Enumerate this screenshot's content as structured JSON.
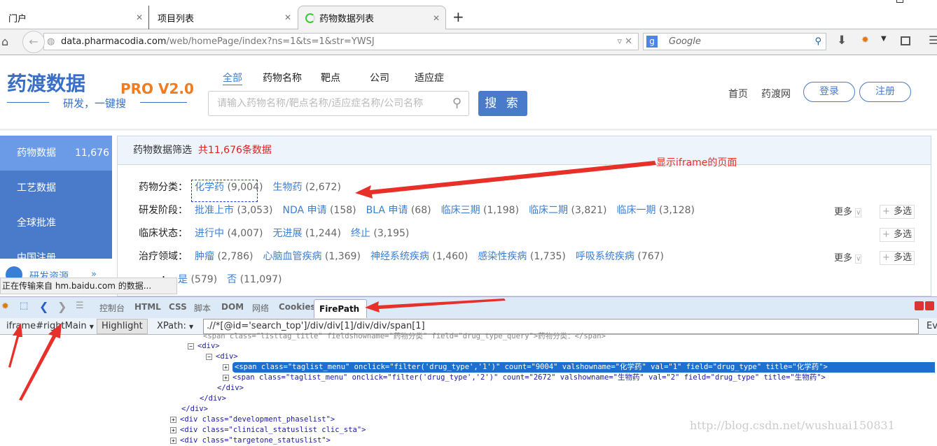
{
  "browser": {
    "tabs": [
      {
        "label": "门户"
      },
      {
        "label": "项目列表"
      },
      {
        "label": "药物数据列表",
        "active": true
      }
    ],
    "new_tab": "+",
    "url_host": "data.pharmacodia.com",
    "url_path": "/web/homePage/index?ns=1&ts=1&str=YWSJ",
    "search_engine": "Google"
  },
  "site": {
    "logo_name": "药渡数据",
    "logo_version": "PRO V2.0",
    "logo_slogan": "研发，一键搜",
    "categories": [
      "全部",
      "药物名称",
      "靶点",
      "公司",
      "适应症"
    ],
    "search_placeholder": "请输入药物名称/靶点名称/适应症名称/公司名称",
    "search_button": "搜 索",
    "links": [
      "首页",
      "药渡网"
    ],
    "login": "登录",
    "register": "注册"
  },
  "sidebar": {
    "items": [
      {
        "label": "药物数据",
        "count": "11,676",
        "active": true
      },
      {
        "label": "工艺数据"
      },
      {
        "label": "全球批准"
      },
      {
        "label": "中国注册"
      }
    ],
    "resources": "研发资源"
  },
  "filter": {
    "title": "药物数据筛选",
    "total": "共11,676条数据",
    "rows": [
      {
        "label": "药物分类：",
        "options": [
          [
            "化学药",
            "(9,004)"
          ],
          [
            "生物药",
            "(2,672)"
          ]
        ]
      },
      {
        "label": "研发阶段：",
        "options": [
          [
            "批准上市",
            "(3,053)"
          ],
          [
            "NDA 申请",
            "(158)"
          ],
          [
            "BLA 申请",
            "(68)"
          ],
          [
            "临床三期",
            "(1,198)"
          ],
          [
            "临床二期",
            "(3,821)"
          ],
          [
            "临床一期",
            "(3,128)"
          ]
        ]
      },
      {
        "label": "临床状态：",
        "options": [
          [
            "进行中",
            "(4,007)"
          ],
          [
            "无进展",
            "(1,244)"
          ],
          [
            "终止",
            "(3,195)"
          ]
        ]
      },
      {
        "label": "治疗领域：",
        "options": [
          [
            "肿瘤",
            "(2,786)"
          ],
          [
            "心脑血管疾病",
            "(1,369)"
          ],
          [
            "神经系统疾病",
            "(1,460)"
          ],
          [
            "感染性疾病",
            "(1,735)"
          ],
          [
            "呼吸系统疾病",
            "(767)"
          ]
        ]
      },
      {
        "label": "：",
        "options": [
          [
            "是",
            "(579)"
          ],
          [
            "否",
            "(11,097)"
          ]
        ]
      }
    ],
    "more": "更多",
    "multi": "多选"
  },
  "annotation": "显示iframe的页面",
  "status_text": "正在传输来自 hm.baidu.com 的数据...",
  "firebug": {
    "tabs": [
      "控制台",
      "HTML",
      "CSS",
      "脚本",
      "DOM",
      "网络",
      "Cookies",
      "FirePath"
    ],
    "frame": "iframe#rightMain",
    "highlight": "Highlight",
    "xpath_label": "XPath:",
    "xpath": ".//*[@id='search_top']/div/div[1]/div/div/span[1]",
    "ev": "Ev",
    "code": [
      "<span class=\"listtag_title\" fieldshowname=\"药物分类\" field=\"drug_type_query\">药物分类：</span>",
      "<div>",
      "<div>",
      "<span class=\"taglist_menu\" onclick=\"filter('drug_type','1')\" count=\"9004\" valshowname=\"化学药\" val=\"1\" field=\"drug_type\" title=\"化学药\">",
      "<span class=\"taglist_menu\" onclick=\"filter('drug_type','2')\" count=\"2672\" valshowname=\"生物药\" val=\"2\" field=\"drug_type\" title=\"生物药\">",
      "</div>",
      "</div>",
      "</div>",
      "<div class=\"development_phaselist\">",
      "<div class=\"clinical_statuslist clic_sta\">",
      "<div class=\"targetone_statuslist\">"
    ]
  },
  "watermark": "http://blog.csdn.net/wushuai150831",
  "colors": {
    "brand": "#4a7bcb",
    "accent": "#f07c22",
    "link": "#3a7fd5",
    "total": "#e02020",
    "arrow": "#e8302a",
    "selection": "#1f6fd1"
  }
}
